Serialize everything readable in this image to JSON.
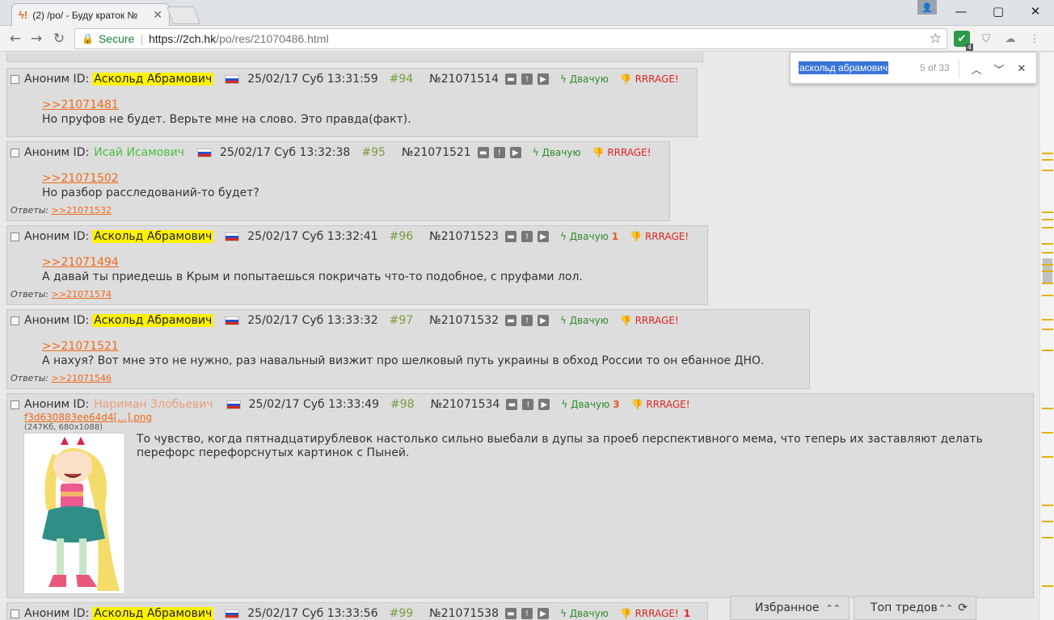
{
  "browser": {
    "tab_title": "(2) /po/ - Буду краток №",
    "tab_favicon": "ϟ!",
    "new_tab": "",
    "window_min": "—",
    "window_max": "▢",
    "window_close": "✕",
    "user_icon": "👤"
  },
  "address": {
    "secure_label": "Secure",
    "host": "https://2ch.hk",
    "path": "/po/res/21070486.html"
  },
  "find": {
    "query": "аскольд абрамович",
    "count": "5 of 33"
  },
  "posts": [
    {
      "anon": "Аноним ID:",
      "name": "Аскольд Абрамович",
      "date": "25/02/17 Суб 13:31:59",
      "num": "#94",
      "pid": "№21071514",
      "dvachu": "Двачую",
      "dv_count": "",
      "rrrage": "RRRAGE!",
      "rr_count": "",
      "ref": ">>21071481",
      "text": "Но пруфов не будет. Верьте мне на слово. Это правда(факт).",
      "replies_label": "",
      "reply": ""
    },
    {
      "anon": "Аноним ID:",
      "name": "Исай Исамович",
      "date": "25/02/17 Суб 13:32:38",
      "num": "#95",
      "pid": "№21071521",
      "dvachu": "Двачую",
      "dv_count": "",
      "rrrage": "RRRAGE!",
      "rr_count": "",
      "ref": ">>21071502",
      "text": "Но разбор расследований-то будет?",
      "replies_label": "Ответы:",
      "reply": ">>21071532"
    },
    {
      "anon": "Аноним ID:",
      "name": "Аскольд Абрамович",
      "date": "25/02/17 Суб 13:32:41",
      "num": "#96",
      "pid": "№21071523",
      "dvachu": "Двачую",
      "dv_count": "1",
      "rrrage": "RRRAGE!",
      "rr_count": "",
      "ref": ">>21071494",
      "text": "А давай ты приедешь в Крым и попытаешься покричать что-то подобное, с пруфами лол.",
      "replies_label": "Ответы:",
      "reply": ">>21071574"
    },
    {
      "anon": "Аноним ID:",
      "name": "Аскольд Абрамович",
      "date": "25/02/17 Суб 13:33:32",
      "num": "#97",
      "pid": "№21071532",
      "dvachu": "Двачую",
      "dv_count": "",
      "rrrage": "RRRAGE!",
      "rr_count": "",
      "ref": ">>21071521",
      "text": "А нахуя? Вот мне это не нужно, раз навальный визжит про шелковый путь украины в обход России то он ебанное ДНО.",
      "replies_label": "Ответы:",
      "reply": ">>21071546"
    },
    {
      "anon": "Аноним ID:",
      "name": "Нариман Злобьевич",
      "date": "25/02/17 Суб 13:33:49",
      "num": "#98",
      "pid": "№21071534",
      "dvachu": "Двачую",
      "dv_count": "3",
      "rrrage": "RRRAGE!",
      "rr_count": "",
      "file_name": "f3d630883ee64d4[...].png",
      "file_size": "(247Кб, 680x1088)",
      "text": "То чувство, когда пятнадцатирублевок настолько сильно выебали в дупы за проеб перспективного мема, что теперь их заставляют делать перефорс перефорснутых картинок с Пыней."
    },
    {
      "anon": "Аноним ID:",
      "name": "Аскольд Абрамович",
      "date": "25/02/17 Суб 13:33:56",
      "num": "#99",
      "pid": "№21071538",
      "dvachu": "Двачую",
      "dv_count": "",
      "rrrage": "RRRAGE!",
      "rr_count": "1"
    }
  ],
  "bottom": {
    "favorites": "Избранное",
    "top_threads": "Топ тредов"
  },
  "colors": {
    "highlight": "#fff200",
    "link": "#f06a1a",
    "post_num": "#7a9c3f",
    "dvachu": "#2f8a2f",
    "rrrage": "#dd2222"
  }
}
